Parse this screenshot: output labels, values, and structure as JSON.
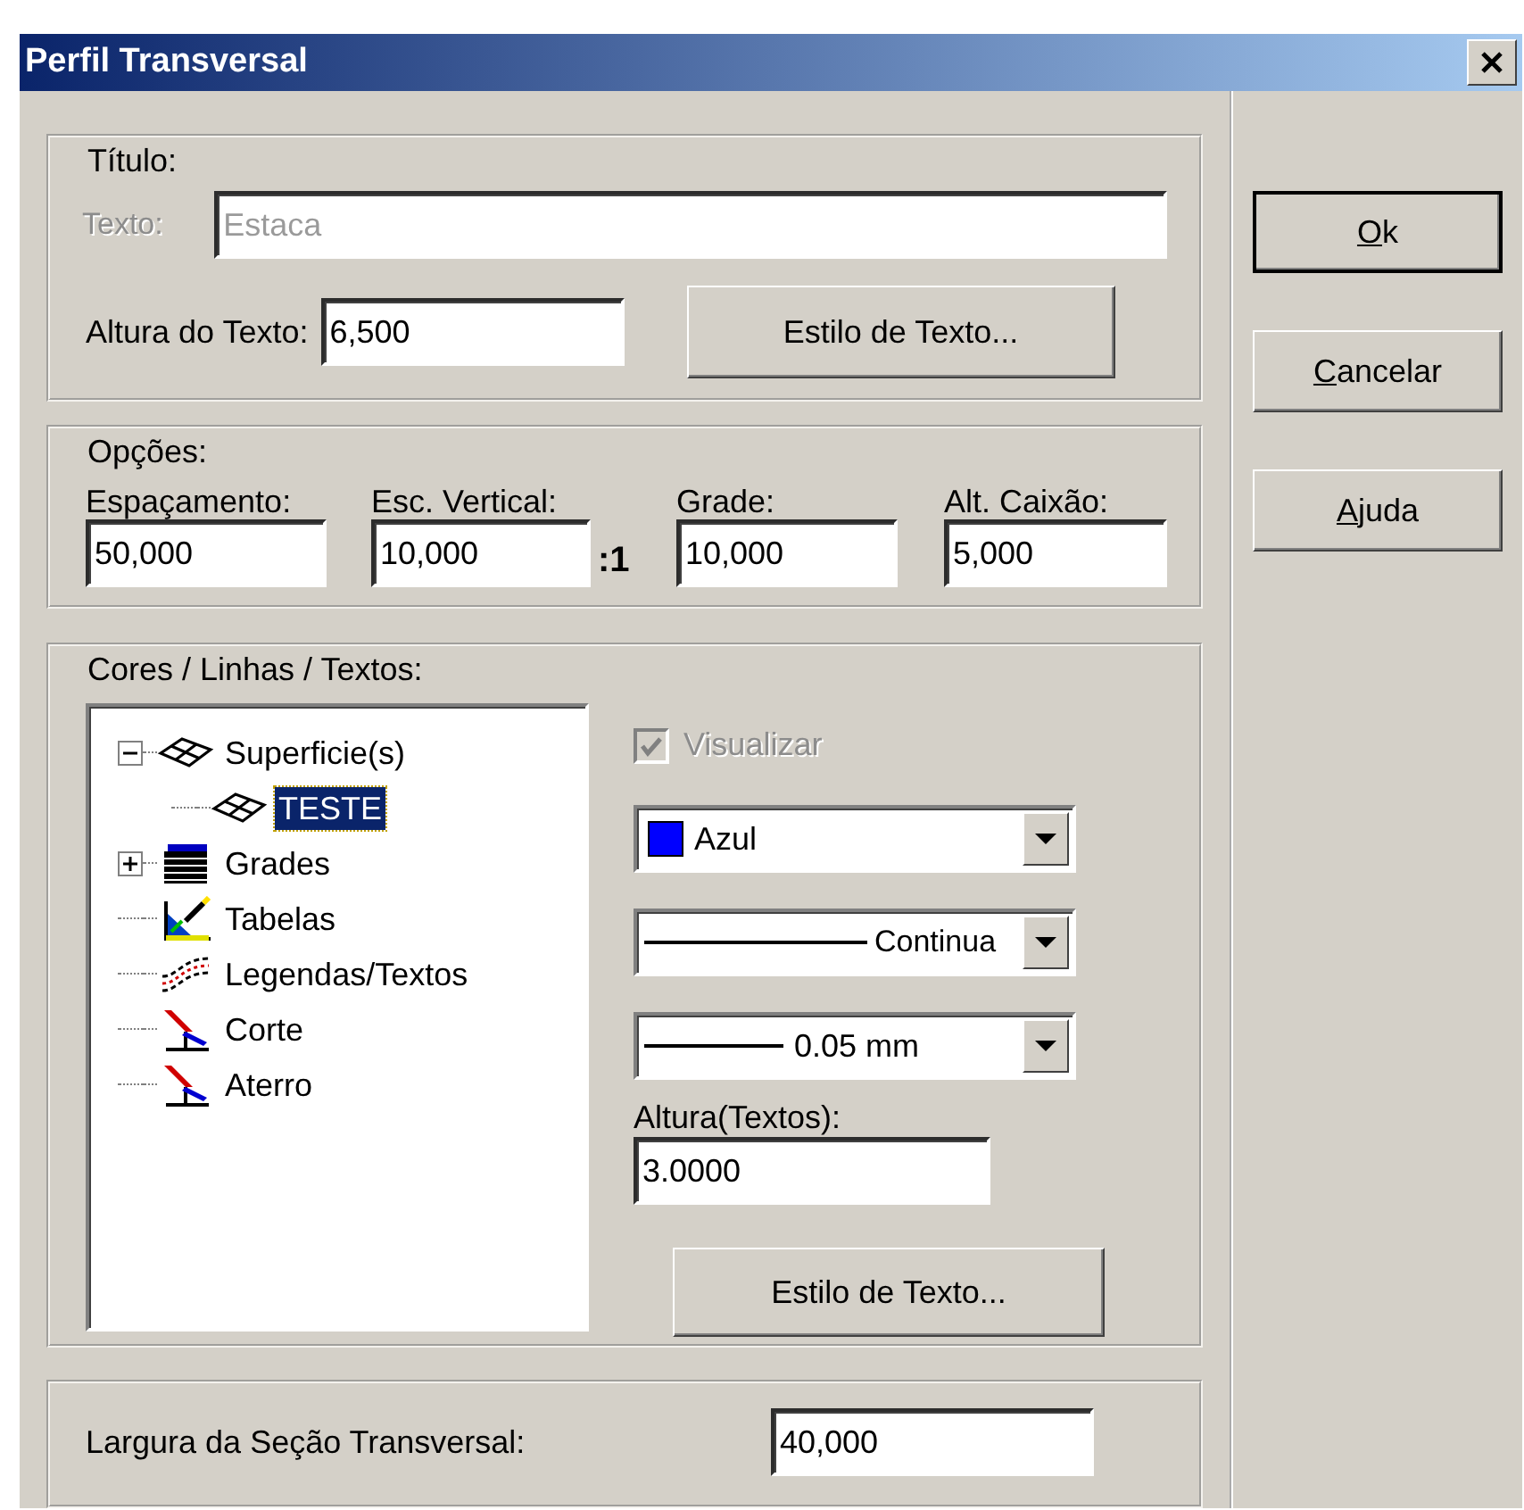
{
  "window": {
    "title": "Perfil Transversal"
  },
  "titulo": {
    "legend": "Título:",
    "texto_label": "Texto:",
    "texto_value": "Estaca",
    "texto_disabled": true,
    "altura_label": "Altura do Texto:",
    "altura_value": "6,500",
    "style_button": "Estilo de Texto..."
  },
  "opcoes": {
    "legend": "Opções:",
    "fields": [
      {
        "label": "Espaçamento:",
        "value": "50,000"
      },
      {
        "label": "Esc. Vertical:",
        "value": "10,000",
        "suffix": ":1"
      },
      {
        "label": "Grade:",
        "value": "10,000"
      },
      {
        "label": "Alt. Caixão:",
        "value": "5,000"
      }
    ]
  },
  "cores": {
    "legend": "Cores / Linhas / Textos:",
    "tree": [
      {
        "label": "Superficie(s)",
        "kind": "surface",
        "expanded": true,
        "selected": false,
        "children": [
          {
            "label": "TESTE",
            "kind": "surface",
            "selected": true
          }
        ]
      },
      {
        "label": "Grades",
        "kind": "grid",
        "expanded": false,
        "selected": false
      },
      {
        "label": "Tabelas",
        "kind": "table",
        "selected": false
      },
      {
        "label": "Legendas/Textos",
        "kind": "legend",
        "selected": false
      },
      {
        "label": "Corte",
        "kind": "cut",
        "selected": false
      },
      {
        "label": "Aterro",
        "kind": "cut",
        "selected": false
      }
    ],
    "visualizar": {
      "label": "Visualizar",
      "checked": true,
      "disabled": true
    },
    "color_combo": {
      "value": "Azul",
      "color": "#0000ff"
    },
    "line_type_combo": {
      "value": "Continua"
    },
    "line_width_combo": {
      "value": "0.05 mm"
    },
    "altura_label": "Altura(Textos):",
    "altura_value": "3.0000",
    "style_button": "Estilo de Texto..."
  },
  "largura": {
    "label": "Largura da Seção Transversal:",
    "value": "40,000"
  },
  "buttons": [
    {
      "label": "Ok",
      "mnemonic": true
    },
    {
      "label": "Cancelar",
      "mnemonic": true
    },
    {
      "label": "Ajuda",
      "mnemonic": true
    }
  ]
}
